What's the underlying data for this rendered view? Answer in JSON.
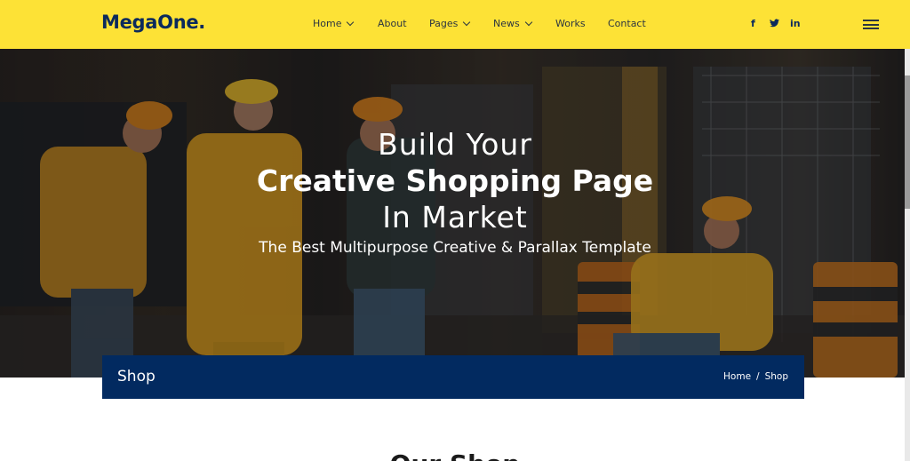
{
  "brand": {
    "logo_text": "MegaOne."
  },
  "nav": {
    "items": [
      {
        "label": "Home",
        "has_dropdown": true
      },
      {
        "label": "About",
        "has_dropdown": false
      },
      {
        "label": "Pages",
        "has_dropdown": true
      },
      {
        "label": "News",
        "has_dropdown": true
      },
      {
        "label": "Works",
        "has_dropdown": false
      },
      {
        "label": "Contact",
        "has_dropdown": false
      }
    ]
  },
  "social": {
    "facebook": "f",
    "twitter": "twitter-icon",
    "linkedin": "in"
  },
  "hero": {
    "line1": "Build Your",
    "line2": "Creative Shopping Page",
    "line3": "In Market",
    "subtitle": "The Best Multipurpose Creative & Parallax Template"
  },
  "page_header": {
    "title": "Shop",
    "breadcrumb": {
      "home": "Home",
      "separator": "/",
      "current": "Shop"
    }
  },
  "section": {
    "heading": "Our Shop"
  },
  "colors": {
    "navbar_bg": "#fde236",
    "brand_navy": "#022a60",
    "logo": "#0b2a5c"
  }
}
